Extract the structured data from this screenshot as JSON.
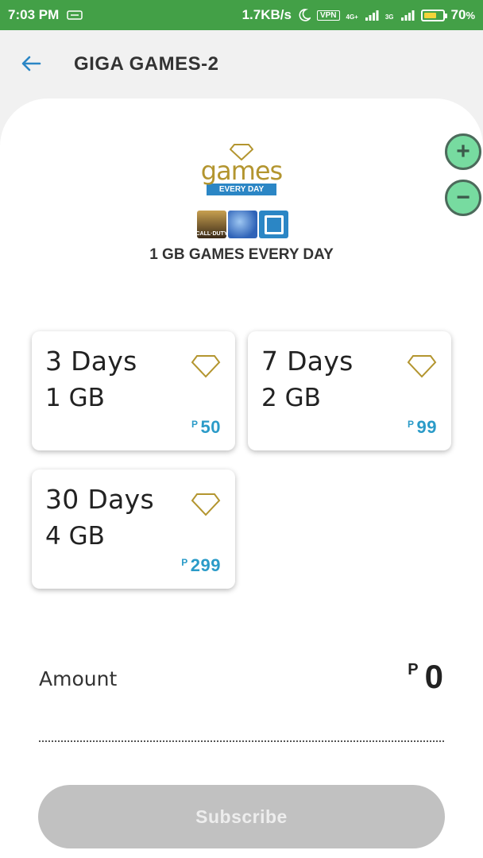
{
  "status_bar": {
    "time": "7:03 PM",
    "net_speed": "1.7KB/s",
    "vpn": "VPN",
    "net1": "4G+",
    "net2": "3G",
    "battery": "70",
    "battery_unit": "%",
    "battery_level": 0.7
  },
  "header": {
    "back_icon": "arrow-left-icon",
    "title": "GIGA GAMES-2"
  },
  "zoom": {
    "in_label": "+",
    "out_label": "−"
  },
  "promo": {
    "logo_word": "games",
    "logo_band": "EVERY DAY",
    "game_icon_1_text": "CALL·DUTY",
    "title": "1 GB GAMES EVERY DAY"
  },
  "plans": [
    {
      "days": "3 Days",
      "data": "1 GB",
      "currency": "P",
      "price": "50"
    },
    {
      "days": "7 Days",
      "data": "2 GB",
      "currency": "P",
      "price": "99"
    },
    {
      "days": "30 Days",
      "data": "4 GB",
      "currency": "P",
      "price": "299"
    }
  ],
  "amount": {
    "label": "Amount",
    "currency": "P",
    "value": "0"
  },
  "subscribe": {
    "label": "Subscribe"
  },
  "colors": {
    "status_bar": "#43a047",
    "accent_blue": "#2b86c5",
    "price_blue": "#2b9bc8",
    "gold": "#b3952f",
    "zoom_button": "#77dba0",
    "disabled_button": "#c1c1c1"
  }
}
